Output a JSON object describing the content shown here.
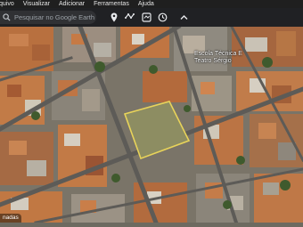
{
  "menu": {
    "items": [
      "Arquivo",
      "Visualizar",
      "Adicionar",
      "Ferramentas",
      "Ajuda"
    ]
  },
  "toolbar": {
    "search_placeholder": "Pesquisar no Google Earth",
    "tools": [
      "location-pin-icon",
      "polygon-icon",
      "path-icon",
      "tour-icon",
      "history-icon",
      "collapse-icon"
    ]
  },
  "map": {
    "place_label_line1": "Escola Técnica E",
    "place_label_line2": "Teatro Sérgio",
    "caption": "nadas",
    "highlight_color": "#e8d35a"
  }
}
